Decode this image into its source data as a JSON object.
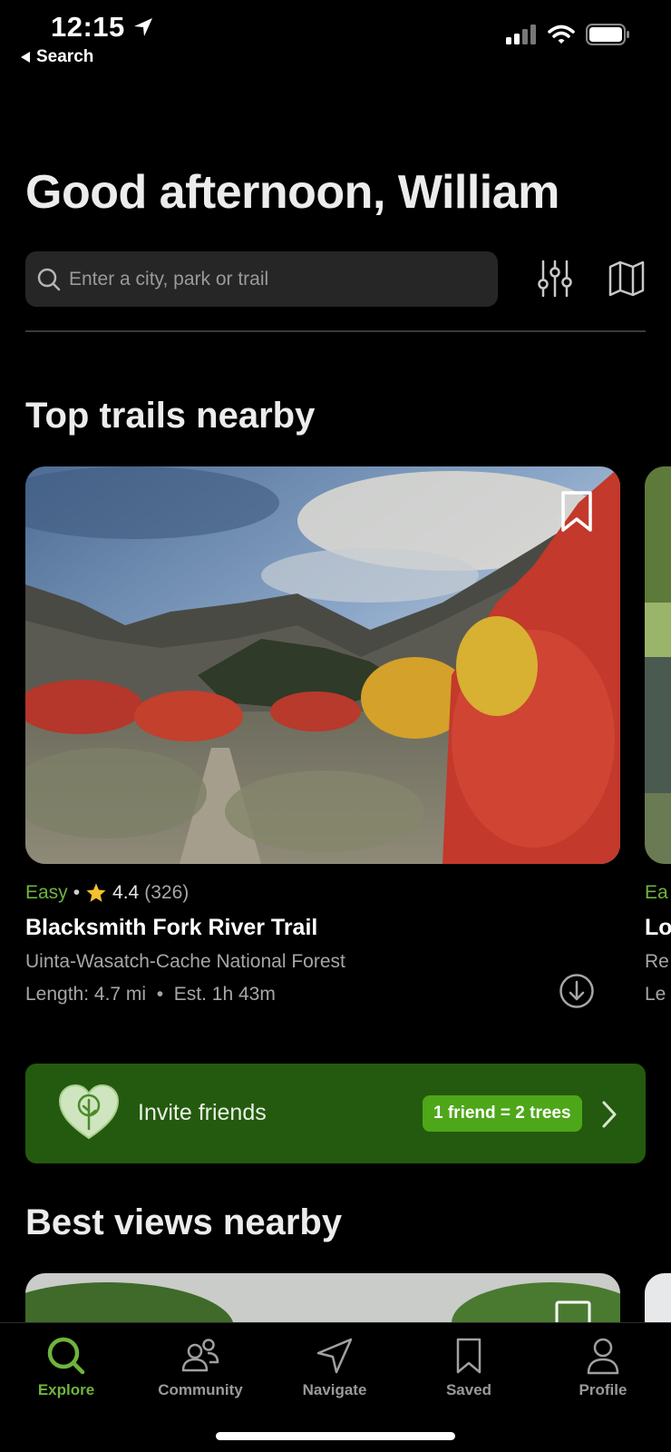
{
  "status_bar": {
    "time": "12:15",
    "back_label": "Search"
  },
  "header": {
    "greeting": "Good afternoon, William"
  },
  "search": {
    "placeholder": "Enter a city, park or trail"
  },
  "sections": {
    "top_trails": "Top trails nearby",
    "best_views": "Best views nearby"
  },
  "trail": {
    "difficulty": "Easy",
    "separator": "•",
    "rating": "4.4",
    "reviews": "(326)",
    "name": "Blacksmith Fork River Trail",
    "location": "Uinta-Wasatch-Cache National Forest",
    "stats": "Length: 4.7 mi  •  Est. 1h 43m"
  },
  "peek_trail": {
    "difficulty": "Ea",
    "name": "Lo",
    "location": "Re",
    "stats": "Le"
  },
  "invite": {
    "label": "Invite friends",
    "badge": "1 friend = 2 trees"
  },
  "tabs": [
    {
      "label": "Explore",
      "icon": "search-icon",
      "active": true
    },
    {
      "label": "Community",
      "icon": "community-icon"
    },
    {
      "label": "Navigate",
      "icon": "navigate-icon"
    },
    {
      "label": "Saved",
      "icon": "bookmark-icon"
    },
    {
      "label": "Profile",
      "icon": "profile-icon"
    }
  ],
  "colors": {
    "accent": "#6fb43c",
    "banner": "#245a0f",
    "badge": "#4ea619",
    "background": "#000000"
  }
}
